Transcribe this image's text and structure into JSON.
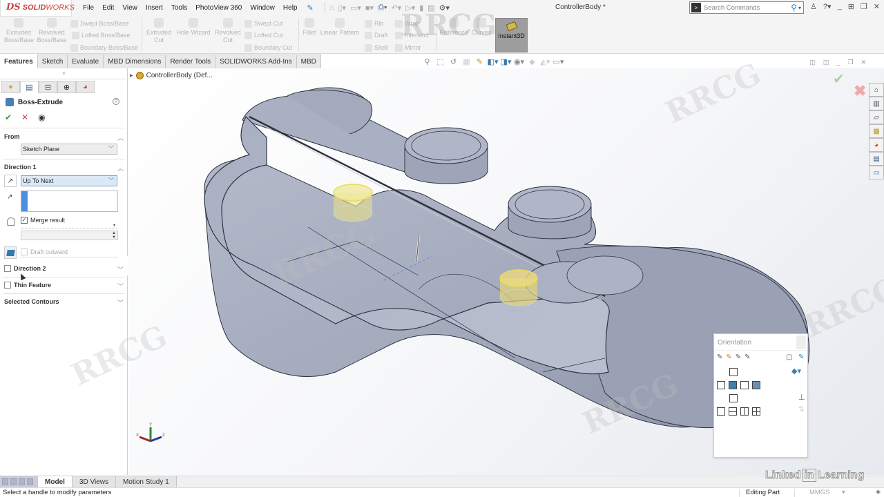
{
  "app": {
    "brand_prefix": "DS",
    "brand_bold": "SOLID",
    "brand_rest": "WORKS",
    "document_title": "ControllerBody *"
  },
  "menu": [
    "File",
    "Edit",
    "View",
    "Insert",
    "Tools",
    "PhotoView 360",
    "Window",
    "Help"
  ],
  "search": {
    "placeholder": "Search Commands"
  },
  "ribbon": {
    "extruded_boss": [
      "Extruded",
      "Boss/Base"
    ],
    "revolved_boss": [
      "Revolved",
      "Boss/Base"
    ],
    "swept_boss": "Swept Boss/Base",
    "lofted_boss": "Lofted Boss/Base",
    "boundary_boss": "Boundary Boss/Base",
    "extruded_cut": [
      "Extruded",
      "Cut"
    ],
    "hole_wizard": "Hole Wizard",
    "revolved_cut": [
      "Revolved",
      "Cut"
    ],
    "swept_cut": "Swept Cut",
    "lofted_cut": "Lofted Cut",
    "boundary_cut": "Boundary Cut",
    "fillet": "Fillet",
    "linear_pattern": "Linear Pattern",
    "rib": "Rib",
    "draft": "Draft",
    "shell": "Shell",
    "wrap": "Wrap",
    "intersect": "Intersect",
    "mirror": "Mirror",
    "reference": "Reference",
    "curves": "Curves",
    "instant3d": "Instant3D"
  },
  "command_tabs": [
    {
      "label": "Features",
      "active": true
    },
    {
      "label": "Sketch",
      "active": false
    },
    {
      "label": "Evaluate",
      "active": false
    },
    {
      "label": "MBD Dimensions",
      "active": false
    },
    {
      "label": "Render Tools",
      "active": false
    },
    {
      "label": "SOLIDWORKS Add-Ins",
      "active": false
    },
    {
      "label": "MBD",
      "active": false
    }
  ],
  "feature_tree": {
    "root": "ControllerBody  (Def..."
  },
  "property_manager": {
    "title": "Boss-Extrude",
    "help": "?",
    "from": {
      "label": "From",
      "value": "Sketch Plane"
    },
    "direction1": {
      "label": "Direction 1",
      "end_condition": "Up To Next",
      "merge_result": {
        "label": "Merge result",
        "checked": true
      },
      "draft_outward": {
        "label": "Draft outward",
        "checked": false
      }
    },
    "direction2": {
      "label": "Direction 2",
      "checked": false
    },
    "thin_feature": {
      "label": "Thin Feature",
      "checked": false
    },
    "selected_contours": {
      "label": "Selected Contours"
    }
  },
  "orientation": {
    "title": "Orientation"
  },
  "triad": {
    "x": "X",
    "y": "Y",
    "z": "Z"
  },
  "bottom_tabs": [
    {
      "label": "Model",
      "active": true
    },
    {
      "label": "3D Views",
      "active": false
    },
    {
      "label": "Motion Study 1",
      "active": false
    }
  ],
  "status": {
    "message": "Select a handle to modify parameters",
    "mode": "Editing Part",
    "units": "MMGS"
  },
  "watermarks": {
    "linkedin_a": "Linked",
    "linkedin_in": "in",
    "linkedin_b": "Learning",
    "rrcg": "RRCG"
  },
  "colors": {
    "brand": "#c8473c",
    "model_fill": "#a9b0c2",
    "model_edge": "#2e3340",
    "preview": "#e8e08a",
    "accept": "#3a9b36",
    "reject": "#dd4444",
    "selection_blue": "#4a90e2"
  }
}
